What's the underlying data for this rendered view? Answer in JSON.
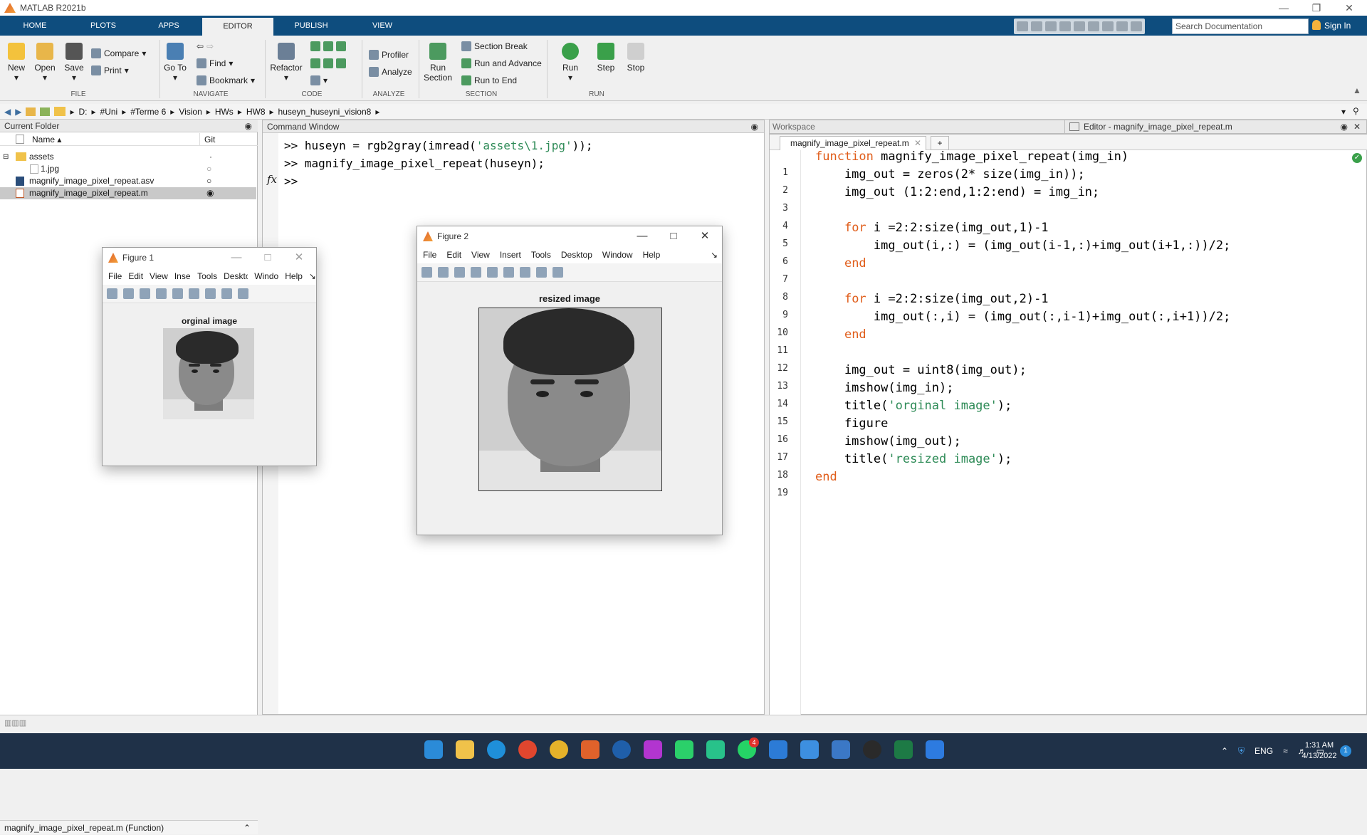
{
  "window": {
    "title": "MATLAB R2021b"
  },
  "tabs": [
    "HOME",
    "PLOTS",
    "APPS",
    "EDITOR",
    "PUBLISH",
    "VIEW"
  ],
  "active_tab": "EDITOR",
  "search": {
    "placeholder": "Search Documentation"
  },
  "signin": "Sign In",
  "ribbon": {
    "file": {
      "new": "New",
      "open": "Open",
      "save": "Save",
      "compare": "Compare",
      "print": "Print",
      "group": "FILE"
    },
    "navigate": {
      "goto": "Go To",
      "find": "Find",
      "bookmark": "Bookmark",
      "group": "NAVIGATE"
    },
    "code": {
      "refactor": "Refactor",
      "group": "CODE"
    },
    "analyze": {
      "profiler": "Profiler",
      "analyze": "Analyze",
      "group": "ANALYZE"
    },
    "section": {
      "run_section": "Run Section",
      "section_break": "Section Break",
      "run_and_advance": "Run and Advance",
      "run_to_end": "Run to End",
      "group": "SECTION"
    },
    "run": {
      "run": "Run",
      "step": "Step",
      "stop": "Stop",
      "group": "RUN"
    }
  },
  "address": {
    "crumbs": [
      "D:",
      "#Uni",
      "#Terme 6",
      "Vision",
      "HWs",
      "HW8",
      "huseyn_huseyni_vision8"
    ]
  },
  "current_folder": {
    "title": "Current Folder",
    "col_name": "Name",
    "col_git": "Git",
    "items": [
      {
        "name": "assets",
        "kind": "folder"
      },
      {
        "name": "1.jpg",
        "kind": "file"
      },
      {
        "name": "magnify_image_pixel_repeat.asv",
        "kind": "file"
      },
      {
        "name": "magnify_image_pixel_repeat.m",
        "kind": "file",
        "selected": true
      }
    ],
    "status": "magnify_image_pixel_repeat.m  (Function)"
  },
  "command_window": {
    "title": "Command Window",
    "lines": [
      {
        "prompt": ">> ",
        "code": "huseyn = rgb2gray(imread(",
        "str": "'assets\\1.jpg'",
        "tail": "));"
      },
      {
        "prompt": ">> ",
        "code": "magnify_image_pixel_repeat(huseyn);",
        "str": "",
        "tail": ""
      },
      {
        "prompt": ">> ",
        "code": "",
        "str": "",
        "tail": ""
      }
    ],
    "fx": "fx"
  },
  "workspace": {
    "title": "Workspace"
  },
  "editor": {
    "title": "Editor - magnify_image_pixel_repeat.m",
    "tab": "magnify_image_pixel_repeat.m",
    "lines": [
      {
        "n": "1",
        "parts": [
          [
            "kw",
            "function"
          ],
          [
            "c",
            " magnify_image_pixel_repeat(img_in)"
          ]
        ]
      },
      {
        "n": "2",
        "parts": [
          [
            "c",
            "    img_out = zeros(2* size(img_in));"
          ]
        ]
      },
      {
        "n": "3",
        "parts": [
          [
            "c",
            "    img_out (1:2:end,1:2:end) = img_in;"
          ]
        ]
      },
      {
        "n": "4",
        "parts": []
      },
      {
        "n": "5",
        "parts": [
          [
            "c",
            "    "
          ],
          [
            "kw",
            "for"
          ],
          [
            "c",
            " i =2:2:size(img_out,1)-1"
          ]
        ]
      },
      {
        "n": "6",
        "parts": [
          [
            "c",
            "        img_out(i,:) = (img_out(i-1,:)+img_out(i+1,:))/2;"
          ]
        ]
      },
      {
        "n": "7",
        "parts": [
          [
            "c",
            "    "
          ],
          [
            "kw",
            "end"
          ]
        ]
      },
      {
        "n": "8",
        "parts": []
      },
      {
        "n": "9",
        "parts": [
          [
            "c",
            "    "
          ],
          [
            "kw",
            "for"
          ],
          [
            "c",
            " i =2:2:size(img_out,2)-1"
          ]
        ]
      },
      {
        "n": "10",
        "parts": [
          [
            "c",
            "        img_out(:,i) = (img_out(:,i-1)+img_out(:,i+1))/2;"
          ]
        ]
      },
      {
        "n": "11",
        "parts": [
          [
            "c",
            "    "
          ],
          [
            "kw",
            "end"
          ]
        ]
      },
      {
        "n": "12",
        "parts": []
      },
      {
        "n": "13",
        "parts": [
          [
            "c",
            "    img_out = uint8(img_out);"
          ]
        ]
      },
      {
        "n": "14",
        "parts": [
          [
            "c",
            "    imshow(img_in);"
          ]
        ]
      },
      {
        "n": "15",
        "parts": [
          [
            "c",
            "    title("
          ],
          [
            "str",
            "'orginal image'"
          ],
          [
            "c",
            ");"
          ]
        ]
      },
      {
        "n": "16",
        "parts": [
          [
            "c",
            "    figure"
          ]
        ]
      },
      {
        "n": "17",
        "parts": [
          [
            "c",
            "    imshow(img_out);"
          ]
        ]
      },
      {
        "n": "18",
        "parts": [
          [
            "c",
            "    title("
          ],
          [
            "str",
            "'resized image'"
          ],
          [
            "c",
            ");"
          ]
        ]
      },
      {
        "n": "19",
        "parts": [
          [
            "kw",
            "end"
          ]
        ]
      }
    ]
  },
  "figure1": {
    "title": "Figure 1",
    "menu": [
      "File",
      "Edit",
      "View",
      "Insert",
      "Tools",
      "Desktop",
      "Window",
      "Help"
    ],
    "axes_title": "orginal image"
  },
  "figure2": {
    "title": "Figure 2",
    "menu": [
      "File",
      "Edit",
      "View",
      "Insert",
      "Tools",
      "Desktop",
      "Window",
      "Help"
    ],
    "axes_title": "resized image"
  },
  "taskbar": {
    "lang": "ENG",
    "time": "1:31 AM",
    "date": "4/13/2022",
    "notif": "1",
    "whatsapp_badge": "4"
  },
  "colors": {
    "tabbar": "#0e4d7e",
    "keyword": "#e05d1a",
    "string": "#2e8b57",
    "taskbar": "#1f3148"
  }
}
